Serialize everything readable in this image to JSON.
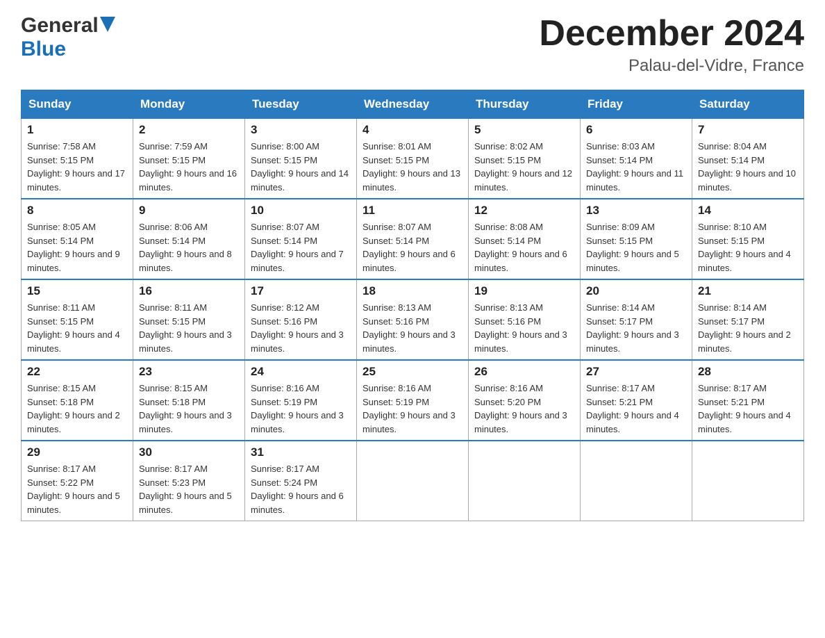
{
  "header": {
    "logo_general": "General",
    "logo_blue": "Blue",
    "month_title": "December 2024",
    "location": "Palau-del-Vidre, France"
  },
  "weekdays": [
    "Sunday",
    "Monday",
    "Tuesday",
    "Wednesday",
    "Thursday",
    "Friday",
    "Saturday"
  ],
  "weeks": [
    [
      {
        "day": "1",
        "sunrise": "7:58 AM",
        "sunset": "5:15 PM",
        "daylight": "9 hours and 17 minutes."
      },
      {
        "day": "2",
        "sunrise": "7:59 AM",
        "sunset": "5:15 PM",
        "daylight": "9 hours and 16 minutes."
      },
      {
        "day": "3",
        "sunrise": "8:00 AM",
        "sunset": "5:15 PM",
        "daylight": "9 hours and 14 minutes."
      },
      {
        "day": "4",
        "sunrise": "8:01 AM",
        "sunset": "5:15 PM",
        "daylight": "9 hours and 13 minutes."
      },
      {
        "day": "5",
        "sunrise": "8:02 AM",
        "sunset": "5:15 PM",
        "daylight": "9 hours and 12 minutes."
      },
      {
        "day": "6",
        "sunrise": "8:03 AM",
        "sunset": "5:14 PM",
        "daylight": "9 hours and 11 minutes."
      },
      {
        "day": "7",
        "sunrise": "8:04 AM",
        "sunset": "5:14 PM",
        "daylight": "9 hours and 10 minutes."
      }
    ],
    [
      {
        "day": "8",
        "sunrise": "8:05 AM",
        "sunset": "5:14 PM",
        "daylight": "9 hours and 9 minutes."
      },
      {
        "day": "9",
        "sunrise": "8:06 AM",
        "sunset": "5:14 PM",
        "daylight": "9 hours and 8 minutes."
      },
      {
        "day": "10",
        "sunrise": "8:07 AM",
        "sunset": "5:14 PM",
        "daylight": "9 hours and 7 minutes."
      },
      {
        "day": "11",
        "sunrise": "8:07 AM",
        "sunset": "5:14 PM",
        "daylight": "9 hours and 6 minutes."
      },
      {
        "day": "12",
        "sunrise": "8:08 AM",
        "sunset": "5:14 PM",
        "daylight": "9 hours and 6 minutes."
      },
      {
        "day": "13",
        "sunrise": "8:09 AM",
        "sunset": "5:15 PM",
        "daylight": "9 hours and 5 minutes."
      },
      {
        "day": "14",
        "sunrise": "8:10 AM",
        "sunset": "5:15 PM",
        "daylight": "9 hours and 4 minutes."
      }
    ],
    [
      {
        "day": "15",
        "sunrise": "8:11 AM",
        "sunset": "5:15 PM",
        "daylight": "9 hours and 4 minutes."
      },
      {
        "day": "16",
        "sunrise": "8:11 AM",
        "sunset": "5:15 PM",
        "daylight": "9 hours and 3 minutes."
      },
      {
        "day": "17",
        "sunrise": "8:12 AM",
        "sunset": "5:16 PM",
        "daylight": "9 hours and 3 minutes."
      },
      {
        "day": "18",
        "sunrise": "8:13 AM",
        "sunset": "5:16 PM",
        "daylight": "9 hours and 3 minutes."
      },
      {
        "day": "19",
        "sunrise": "8:13 AM",
        "sunset": "5:16 PM",
        "daylight": "9 hours and 3 minutes."
      },
      {
        "day": "20",
        "sunrise": "8:14 AM",
        "sunset": "5:17 PM",
        "daylight": "9 hours and 3 minutes."
      },
      {
        "day": "21",
        "sunrise": "8:14 AM",
        "sunset": "5:17 PM",
        "daylight": "9 hours and 2 minutes."
      }
    ],
    [
      {
        "day": "22",
        "sunrise": "8:15 AM",
        "sunset": "5:18 PM",
        "daylight": "9 hours and 2 minutes."
      },
      {
        "day": "23",
        "sunrise": "8:15 AM",
        "sunset": "5:18 PM",
        "daylight": "9 hours and 3 minutes."
      },
      {
        "day": "24",
        "sunrise": "8:16 AM",
        "sunset": "5:19 PM",
        "daylight": "9 hours and 3 minutes."
      },
      {
        "day": "25",
        "sunrise": "8:16 AM",
        "sunset": "5:19 PM",
        "daylight": "9 hours and 3 minutes."
      },
      {
        "day": "26",
        "sunrise": "8:16 AM",
        "sunset": "5:20 PM",
        "daylight": "9 hours and 3 minutes."
      },
      {
        "day": "27",
        "sunrise": "8:17 AM",
        "sunset": "5:21 PM",
        "daylight": "9 hours and 4 minutes."
      },
      {
        "day": "28",
        "sunrise": "8:17 AM",
        "sunset": "5:21 PM",
        "daylight": "9 hours and 4 minutes."
      }
    ],
    [
      {
        "day": "29",
        "sunrise": "8:17 AM",
        "sunset": "5:22 PM",
        "daylight": "9 hours and 5 minutes."
      },
      {
        "day": "30",
        "sunrise": "8:17 AM",
        "sunset": "5:23 PM",
        "daylight": "9 hours and 5 minutes."
      },
      {
        "day": "31",
        "sunrise": "8:17 AM",
        "sunset": "5:24 PM",
        "daylight": "9 hours and 6 minutes."
      },
      null,
      null,
      null,
      null
    ]
  ]
}
